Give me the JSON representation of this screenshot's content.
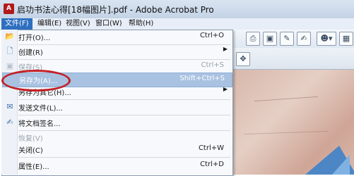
{
  "window": {
    "title": "启功书法心得[18幅图片].pdf - Adobe Acrobat Pro",
    "app_icon": "acrobat-logo"
  },
  "menubar": {
    "items": [
      {
        "label": "文件(F)",
        "active": true
      },
      {
        "label": "编辑(E)"
      },
      {
        "label": "视图(V)"
      },
      {
        "label": "窗口(W)"
      },
      {
        "label": "帮助(H)"
      }
    ]
  },
  "file_menu": {
    "items": [
      {
        "label": "打开(O)...",
        "shortcut": "Ctrl+O",
        "icon": "folder-open-icon"
      },
      {
        "label": "创建(R)",
        "icon": "create-pdf-icon",
        "submenu": true
      },
      {
        "label": "保存(S)",
        "shortcut": "Ctrl+S",
        "disabled": true,
        "icon": "save-icon"
      },
      {
        "label": "另存为(A)...",
        "shortcut": "Shift+Ctrl+S",
        "highlighted": true
      },
      {
        "label": "另存为其它(H)...",
        "submenu": true
      },
      {
        "label": "发送文件(L)...",
        "icon": "envelope-icon"
      },
      {
        "label": "将文档签名...",
        "icon": "sign-icon"
      },
      {
        "label": "恢复(V)",
        "disabled": true
      },
      {
        "label": "关闭(C)",
        "shortcut": "Ctrl+W"
      },
      {
        "label": "属性(E)...",
        "shortcut": "Ctrl+D"
      }
    ]
  },
  "toolbar": {
    "icons": [
      "print-icon",
      "save-icon",
      "sign-icon",
      "user-icon",
      "options-icon"
    ]
  },
  "annotation": {
    "color": "#c32026"
  }
}
